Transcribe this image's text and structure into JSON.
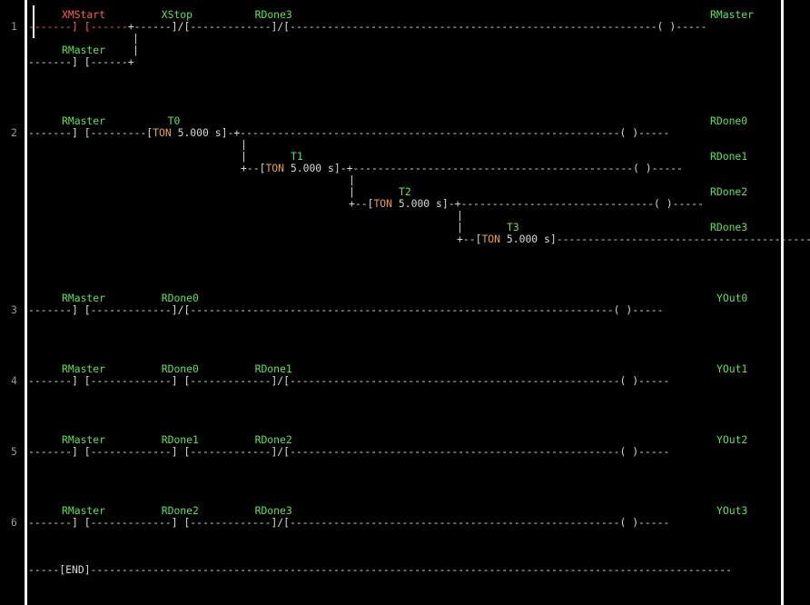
{
  "colors": {
    "background": "#000000",
    "line": "#d8d8d8",
    "label_green": "#5ee05e",
    "label_red": "#ff5f5f",
    "timer_orange": "#e8a040",
    "line_red": "#ff5f5f"
  },
  "rung_numbers": [
    "1",
    "2",
    "3",
    "4",
    "5",
    "6"
  ],
  "rung1": {
    "labels": "XMStart         XStop          RDone3",
    "coil_label": "RMaster",
    "line_red": "-------] [------",
    "line_white": "+------]/[-------------]/[-----------------------------------------------------------( )-----",
    "branch_label": "RMaster",
    "branch_line": "-------] [------+"
  },
  "rung2": {
    "main_label": "RMaster          T0",
    "coil0": "RDone0",
    "line_a": "-------] [---------[",
    "timer_kw": "TON",
    "timer_val": " 5.000 s",
    "line_b": "]-+-------------------------------------------------------------( )-----",
    "t1": "T1",
    "coil1": "RDone1",
    "line_t1a": "+--[",
    "line_t1b": "]-+---------------------------------------------( )-----",
    "t2": "T2",
    "coil2": "RDone2",
    "line_t2a": "+--[",
    "line_t2b": "]-+-------------------------------( )-----",
    "t3": "T3",
    "coil3": "RDone3",
    "line_t3a": "+--[",
    "line_t3b": "]-------------------------------------------( )-----"
  },
  "rung3": {
    "labels": "RMaster         RDone0",
    "coil": "YOut0",
    "line": "-------] [-------------]/[--------------------------------------------------------------------( )-----"
  },
  "rung4": {
    "labels": "RMaster         RDone0         RDone1",
    "coil": "YOut1",
    "line": "-------] [-------------] [-------------]/[-----------------------------------------------------( )-----"
  },
  "rung5": {
    "labels": "RMaster         RDone1         RDone2",
    "coil": "YOut2",
    "line": "-------] [-------------] [-------------]/[-----------------------------------------------------( )-----"
  },
  "rung6": {
    "labels": "RMaster         RDone2         RDone3",
    "coil": "YOut3",
    "line": "-------] [-------------] [-------------]/[-----------------------------------------------------( )-----"
  },
  "end_line": "-----[END]-------------------------------------------------------------------------------------------------------"
}
